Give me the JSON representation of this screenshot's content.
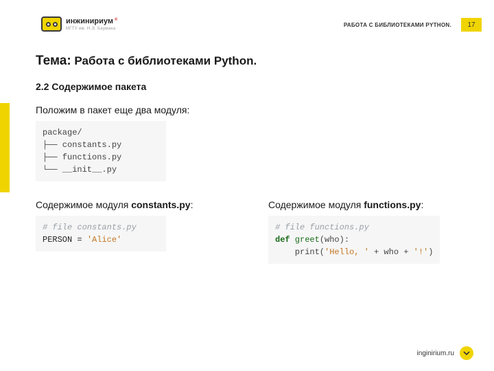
{
  "header": {
    "brand_name": "инжинириум",
    "brand_sub": "МГТУ им. Н.Э. Баумана",
    "reg_mark": "®",
    "running_title": "РАБОТА С БИБЛИОТЕКАМИ PYTHON.",
    "page_number": "17"
  },
  "topic": {
    "prefix": "Тема:",
    "text": " Работа с библиотеками Python."
  },
  "section_heading": "2.2 Содержимое пакета",
  "intro_para": "Положим в пакет еще два модуля:",
  "tree_code": "package/\n├── constants.py\n├── functions.py\n└── __init__.py",
  "left": {
    "label_plain": "Содержимое модуля ",
    "label_bold": "constants.py",
    "label_tail": ":",
    "code": {
      "l1": "# file constants.py",
      "l2a": "PERSON = ",
      "l2b": "'Alice'"
    }
  },
  "right": {
    "label_plain": "Содержимое модуля ",
    "label_bold": "functions.py",
    "label_tail": ":",
    "code": {
      "l1": "# file functions.py",
      "l2a": "def",
      "l2b": " greet",
      "l2c": "(who):",
      "l3a": "    print(",
      "l3b": "'Hello, '",
      "l3c": " + who + ",
      "l3d": "'!'",
      "l3e": ")"
    }
  },
  "footer": {
    "site": "inginirium.ru"
  }
}
